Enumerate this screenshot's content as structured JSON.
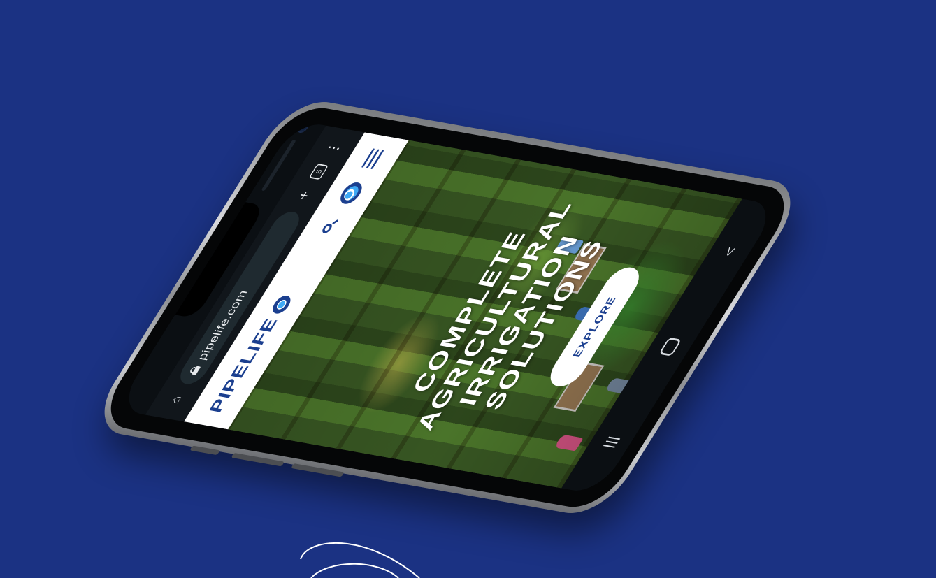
{
  "browser": {
    "url": "pipelife.com",
    "tab_count": "5",
    "plus_icon": "+",
    "more_icon": "⋮",
    "home_icon": "⌂"
  },
  "site": {
    "logo_text": "PIPELIFE",
    "hero_title_lines": [
      "COMPLETE",
      "AGRICULTURAL",
      "IRRIGATION",
      "SOLUTIONS"
    ],
    "explore_label": "EXPLORE"
  },
  "android_nav": {
    "recent_icon": "|||",
    "back_icon": "<"
  },
  "colors": {
    "background": "#1b3283",
    "brand_blue": "#1b3f8f",
    "brand_light_blue": "#3fa9f5",
    "header_bg": "#ffffff"
  },
  "icons": [
    "home-icon",
    "lock-icon",
    "plus-icon",
    "tabs-icon",
    "more-icon",
    "search-icon",
    "globe-icon",
    "menu-icon",
    "recent-apps-icon",
    "home-nav-icon",
    "back-icon"
  ]
}
